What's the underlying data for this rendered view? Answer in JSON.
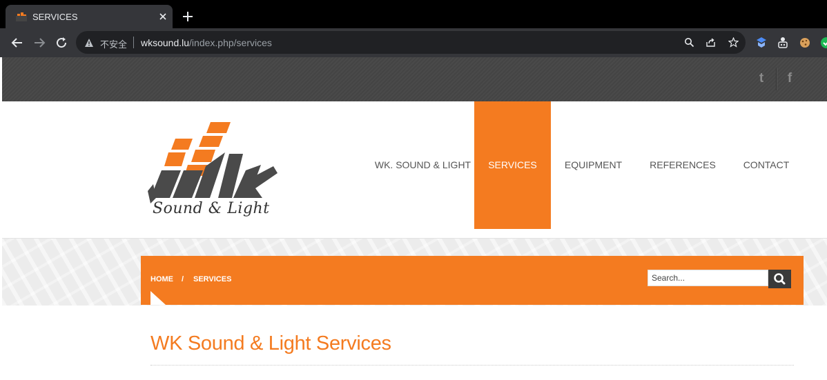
{
  "browser": {
    "tab_title": "SERVICES",
    "security_label": "不安全",
    "url_host": "wksound.lu",
    "url_path": "/index.php/services"
  },
  "social": {
    "items": [
      {
        "name": "twitter",
        "glyph": "t"
      },
      {
        "name": "facebook",
        "glyph": "f"
      }
    ]
  },
  "logo": {
    "script_text": "Sound & Light"
  },
  "nav": {
    "items": [
      {
        "label": "WK. SOUND & LIGHT",
        "active": false
      },
      {
        "label": "SERVICES",
        "active": true
      },
      {
        "label": "EQUIPMENT",
        "active": false
      },
      {
        "label": "REFERENCES",
        "active": false
      },
      {
        "label": "CONTACT",
        "active": false
      }
    ]
  },
  "breadcrumb": {
    "home": "HOME",
    "separator": "/",
    "current": "SERVICES"
  },
  "search": {
    "placeholder": "Search..."
  },
  "page": {
    "title": "WK Sound & Light Services"
  },
  "colors": {
    "accent": "#f47b20",
    "dark": "#444444"
  }
}
